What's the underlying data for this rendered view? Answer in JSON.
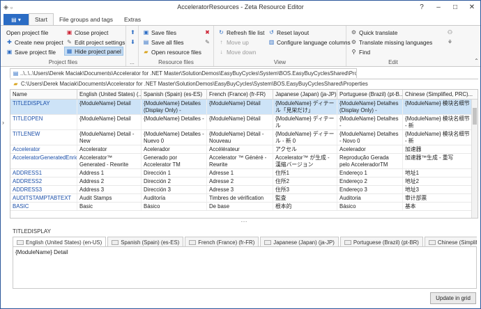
{
  "window": {
    "title": "AcceleratorResources - Zeta Resource Editor"
  },
  "window_controls": {
    "help": "?",
    "minimize": "–",
    "maximize": "□",
    "close": "✕"
  },
  "ribbon_tabs": {
    "file": "▤ ▾",
    "start": "Start",
    "file_groups": "File groups and tags",
    "extras": "Extras"
  },
  "groups": {
    "project_files": {
      "label": "Project files",
      "open": "Open project file",
      "create": "Create new project",
      "save": "Save project file",
      "close": "Close project",
      "edit": "Edit project settings",
      "hide": "Hide project panel"
    },
    "more": {
      "label": "..."
    },
    "resource_files": {
      "label": "Resource files",
      "save": "Save files",
      "save_all": "Save all files",
      "open": "Open resource files"
    },
    "view": {
      "label": "View",
      "refresh": "Refresh file list",
      "move_up": "Move up",
      "move_down": "Move down",
      "reset": "Reset layout",
      "configure": "Configure language columns"
    },
    "edit": {
      "label": "Edit",
      "quick": "Quick translate",
      "missing": "Translate missing languages",
      "find": "Find"
    }
  },
  "breadcrumb": "..\\..\\..\\Users\\Derek Maciak\\Documents\\Accelerator for .NET Master\\SolutionDemos\\EasyBuyCycles\\System\\BOS.EasyBuyCyclesShared\\Properties\\DescriptionResource",
  "path": "C:\\Users\\Derek Maciak\\Documents\\Accelerator for .NET Master\\SolutionDemos\\EasyBuyCycles\\System\\BOS.EasyBuyCyclesShared\\Properties",
  "grid": {
    "columns": [
      "Name",
      "English (United States) (...",
      "Spanish (Spain) (es-ES)",
      "French (France) (fr-FR)",
      "Japanese (Japan) (ja-JP)",
      "Portuguese (Brazil) (pt-B...",
      "Chinese (Simplified, PRC)..."
    ],
    "rows": [
      [
        "TITLEDISPLAY",
        "{ModuleName} Detail",
        "{ModuleName} Detalles (Display Only) -",
        "{ModuleName} Détail",
        "{ModuleName} ディテール「見栄だけ」",
        "{ModuleName} Detalhes (Display Only) -",
        "{ModuleName} 模块名细节"
      ],
      [
        "TITLEOPEN",
        "{ModuleName} Detail",
        "{ModuleName} Detalles -",
        "{ModuleName} Détail",
        "{ModuleName} ディテール",
        "{ModuleName} Detalhes -",
        "{ModuleName} 模块名细节 - 新"
      ],
      [
        "TITLENEW",
        "{ModuleName} Detail - New",
        "{ModuleName} Detalles - Nuevo 0",
        "{ModuleName} Détail - Nouveau",
        "{ModuleName} ディテール - 新 0",
        "{ModuleName} Detalhes - Novo 0",
        "{ModuleName} 模块名细节 - 新"
      ],
      [
        "Accelerator",
        "Accelerator",
        "Acelerador",
        "Accélérateur",
        "アクセル",
        "Acelerador",
        "加速器"
      ],
      [
        "AcceleratorGeneratedEnrichedVersion",
        "Accelerator™ Generated - Rewrite",
        "Generado por Accelerator TM",
        "Accelerator ™ Généré - Rewrite",
        "Accelerator™ が生成 - 漢縮バージョン",
        "Reprodução Gerada pelo AcceleradorTM",
        "加速器™生成 - 重写"
      ],
      [
        "ADDRESS1",
        "Address 1",
        "Dirección 1",
        "Adresse 1",
        "住所1",
        "Endereço 1",
        "地址1"
      ],
      [
        "ADDRESS2",
        "Address 2",
        "Dirección 2",
        "Adresse 2",
        "住所2",
        "Endereço 2",
        "地址2"
      ],
      [
        "ADDRESS3",
        "Address 3",
        "Dirección 3",
        "Adresse 3",
        "住所3",
        "Endereço 3",
        "地址3"
      ],
      [
        "AUDITSTAMPTABTEXT",
        "Audit Stamps",
        "Auditoría",
        "Timbres de vérification",
        "監査",
        "Auditoria",
        "审计部票"
      ],
      [
        "BASIC",
        "Basic",
        "Básico",
        "De base",
        "根本的",
        "Básico",
        "基本"
      ]
    ]
  },
  "splitter": "....",
  "selected_key": "TITLEDISPLAY",
  "lang_tabs": [
    "English (United States) (en-US)",
    "Spanish (Spain) (es-ES)",
    "French (France) (fr-FR)",
    "Japanese (Japan) (ja-JP)",
    "Portuguese (Brazil) (pt-BR)",
    "Chinese (Simplified, P"
  ],
  "editor_value": "{ModuleName} Detail",
  "update_button": "Update in grid",
  "colors": {
    "accent": "#2b6cc4",
    "selection": "#cde3f7",
    "key_text": "#1a4ea8"
  }
}
